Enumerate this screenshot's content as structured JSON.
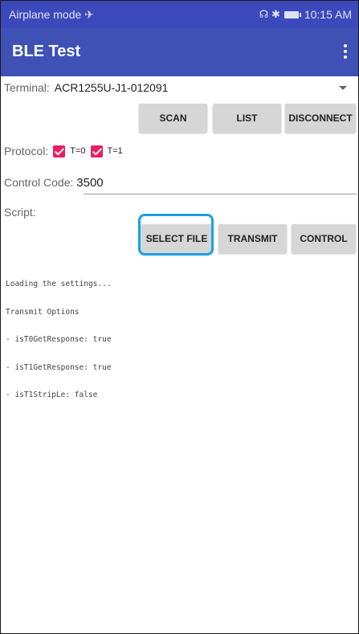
{
  "status_bar": {
    "left_text": "Airplane mode ✈",
    "right_icons": "☊ ✱",
    "time": "10:15 AM"
  },
  "app_bar": {
    "title": "BLE Test",
    "overflow_icon": "overflow-menu-icon"
  },
  "terminal": {
    "label": "Terminal:",
    "value": "ACR1255U-J1-012091"
  },
  "top_buttons": {
    "scan": "SCAN",
    "list": "LIST",
    "disconnect": "DISCONNECT"
  },
  "protocol": {
    "label": "Protocol:",
    "t0_label": "T=0",
    "t1_label": "T=1",
    "t0_checked": true,
    "t1_checked": true
  },
  "control_code": {
    "label": "Control Code:",
    "value": "3500"
  },
  "script": {
    "label": "Script:"
  },
  "bottom_buttons": {
    "select_file": "SELECT FILE",
    "transmit": "TRANSMIT",
    "control": "CONTROL"
  },
  "log": {
    "lines": [
      "Loading the settings...",
      "Transmit Options",
      "- isT0GetResponse: true",
      "- isT1GetResponse: true",
      "- isT1StripLe: false"
    ]
  },
  "colors": {
    "status_bar": "#3c49ba",
    "app_bar": "#3f51b5",
    "checkbox": "#e91e63",
    "highlight": "#1aa1e0"
  }
}
